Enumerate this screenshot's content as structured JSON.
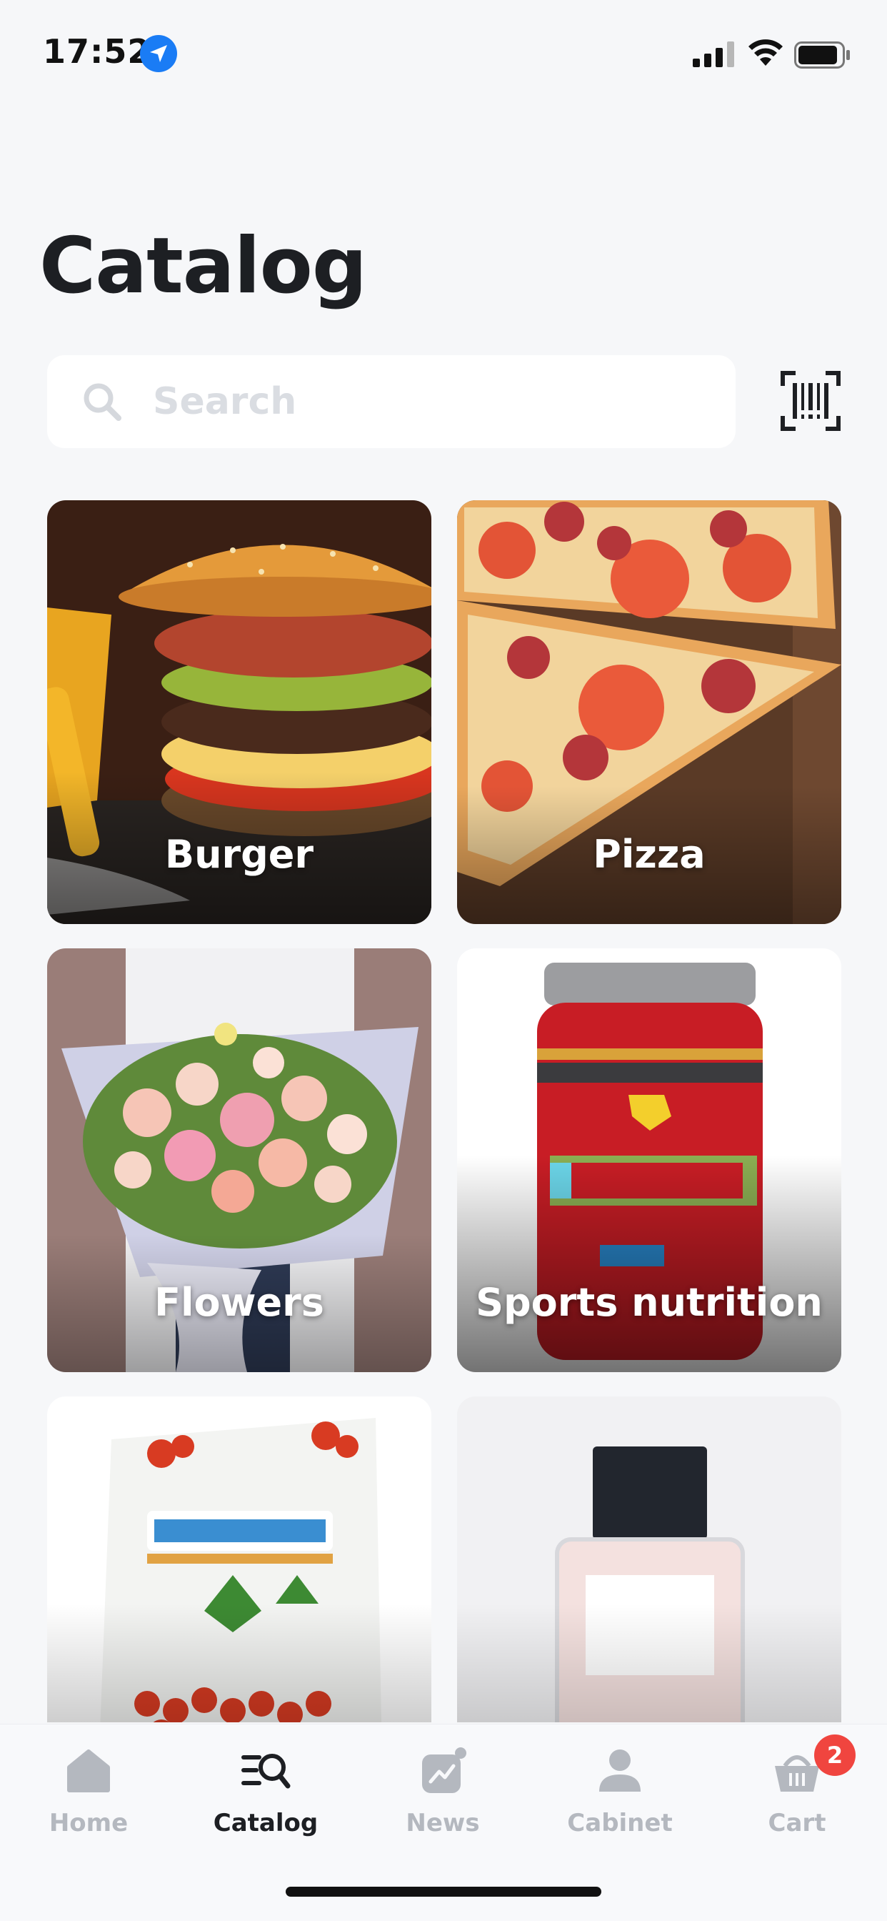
{
  "status_bar": {
    "time": "17:52"
  },
  "page": {
    "title": "Catalog"
  },
  "search": {
    "placeholder": "Search"
  },
  "categories": [
    {
      "label": "Burger"
    },
    {
      "label": "Pizza"
    },
    {
      "label": "Flowers"
    },
    {
      "label": "Sports nutrition"
    },
    {
      "label": ""
    },
    {
      "label": ""
    }
  ],
  "bottom_nav": {
    "items": [
      {
        "label": "Home",
        "icon": "home-icon"
      },
      {
        "label": "Catalog",
        "icon": "catalog-search-icon"
      },
      {
        "label": "News",
        "icon": "news-icon"
      },
      {
        "label": "Cabinet",
        "icon": "user-icon"
      },
      {
        "label": "Cart",
        "icon": "basket-icon"
      }
    ],
    "cart_count": "2"
  },
  "colors": {
    "accent_badge": "#f0453f",
    "location_blue": "#1a7cf5",
    "active_text": "#1d1f23",
    "inactive_text": "#b4b8bf"
  }
}
